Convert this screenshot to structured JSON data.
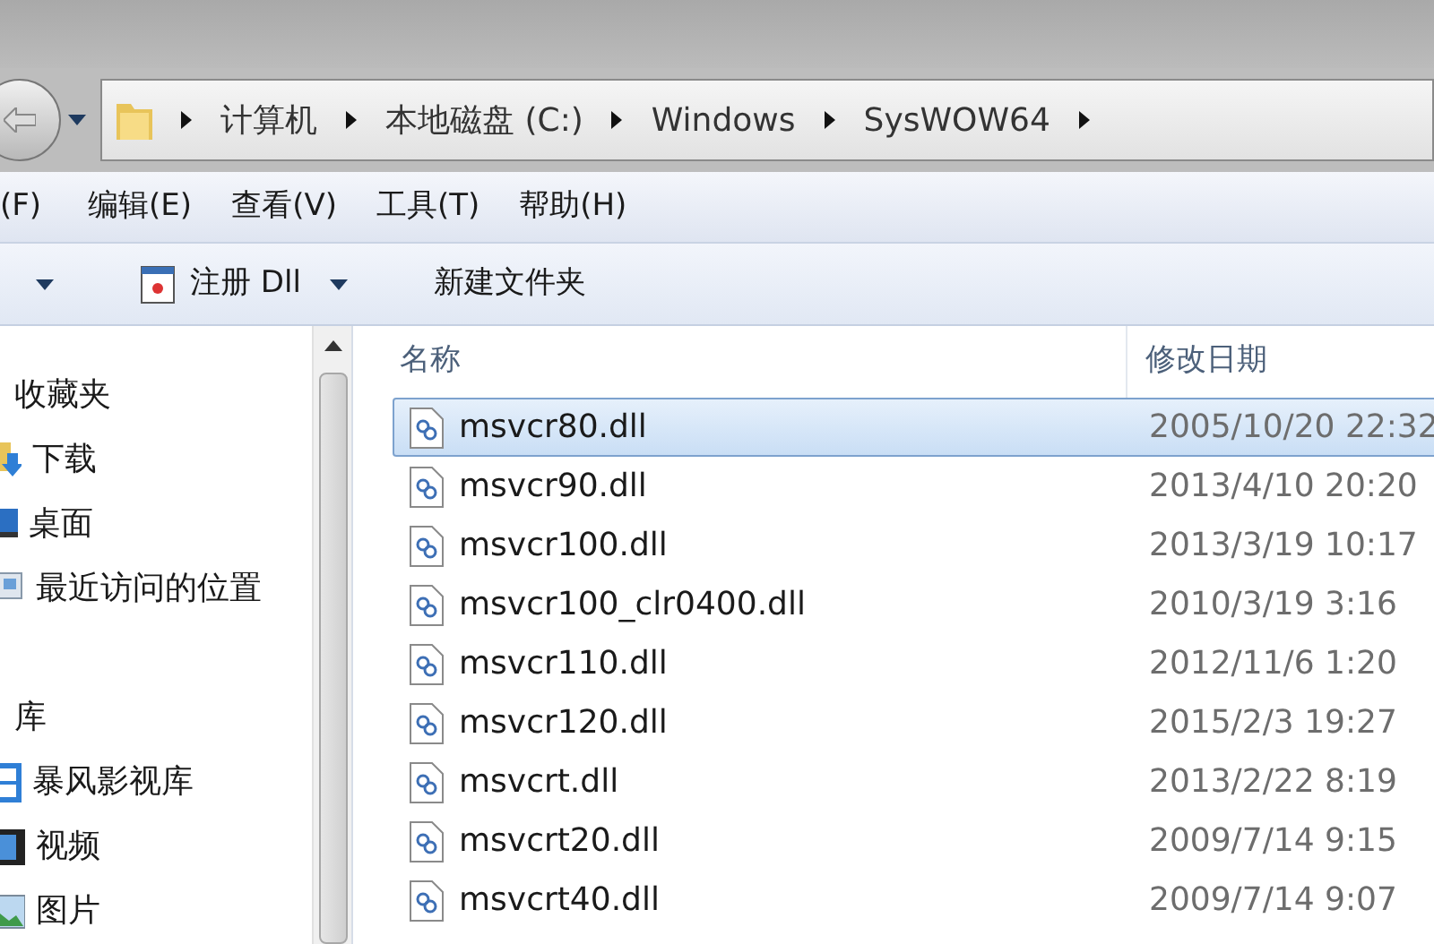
{
  "breadcrumb": [
    "计算机",
    "本地磁盘 (C:)",
    "Windows",
    "SysWOW64"
  ],
  "menu": [
    "(F)",
    "编辑(E)",
    "查看(V)",
    "工具(T)",
    "帮助(H)"
  ],
  "toolbar": {
    "register": "注册 Dll",
    "new_folder": "新建文件夹"
  },
  "nav": [
    {
      "kind": "group",
      "label": "收藏夹"
    },
    {
      "kind": "download",
      "label": "下载"
    },
    {
      "kind": "desktop",
      "label": "桌面"
    },
    {
      "kind": "recent",
      "label": "最近访问的位置"
    },
    {
      "kind": "gap"
    },
    {
      "kind": "group",
      "label": "库"
    },
    {
      "kind": "library",
      "label": "暴风影视库"
    },
    {
      "kind": "video",
      "label": "视频"
    },
    {
      "kind": "picture",
      "label": "图片"
    }
  ],
  "columns": [
    "名称",
    "修改日期"
  ],
  "files": [
    {
      "name": "msvcr80.dll",
      "date": "2005/10/20 22:32",
      "selected": true
    },
    {
      "name": "msvcr90.dll",
      "date": "2013/4/10 20:20",
      "selected": false
    },
    {
      "name": "msvcr100.dll",
      "date": "2013/3/19 10:17",
      "selected": false
    },
    {
      "name": "msvcr100_clr0400.dll",
      "date": "2010/3/19 3:16",
      "selected": false
    },
    {
      "name": "msvcr110.dll",
      "date": "2012/11/6 1:20",
      "selected": false
    },
    {
      "name": "msvcr120.dll",
      "date": "2015/2/3 19:27",
      "selected": false
    },
    {
      "name": "msvcrt.dll",
      "date": "2013/2/22 8:19",
      "selected": false
    },
    {
      "name": "msvcrt20.dll",
      "date": "2009/7/14 9:15",
      "selected": false
    },
    {
      "name": "msvcrt40.dll",
      "date": "2009/7/14 9:07",
      "selected": false
    }
  ]
}
